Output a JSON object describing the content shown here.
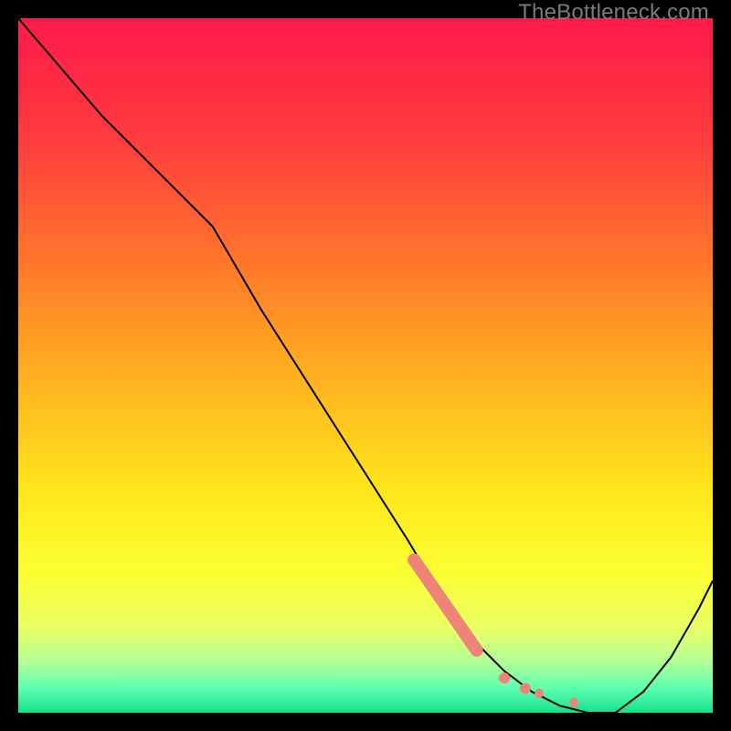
{
  "watermark": "TheBottleneck.com",
  "chart_data": {
    "type": "line",
    "title": "",
    "xlabel": "",
    "ylabel": "",
    "xlim": [
      0,
      100
    ],
    "ylim": [
      0,
      100
    ],
    "background_gradient": {
      "type": "vertical",
      "stops": [
        {
          "offset": 0.0,
          "color": "#ff1a4b"
        },
        {
          "offset": 0.18,
          "color": "#ff3d3d"
        },
        {
          "offset": 0.36,
          "color": "#ff7a2a"
        },
        {
          "offset": 0.52,
          "color": "#ffb21f"
        },
        {
          "offset": 0.68,
          "color": "#ffe61a"
        },
        {
          "offset": 0.8,
          "color": "#fcff33"
        },
        {
          "offset": 0.88,
          "color": "#e8ff66"
        },
        {
          "offset": 0.93,
          "color": "#acff99"
        },
        {
          "offset": 0.965,
          "color": "#5cffb0"
        },
        {
          "offset": 1.0,
          "color": "#18e08c"
        }
      ]
    },
    "series": [
      {
        "name": "bottleneck-curve",
        "color": "#000000",
        "width": 2,
        "x": [
          0,
          6,
          12,
          20,
          28,
          35,
          42,
          49,
          56,
          62,
          66,
          70,
          74,
          78,
          82,
          86,
          90,
          94,
          98,
          100
        ],
        "y": [
          100,
          93,
          86,
          78,
          70,
          58,
          47,
          36,
          25,
          15,
          10,
          6,
          3,
          1,
          0,
          0,
          3,
          8,
          15,
          19
        ]
      }
    ],
    "highlight": {
      "color": "#ee8378",
      "thick_segment": {
        "x": [
          57,
          66
        ],
        "y": [
          22,
          9
        ]
      },
      "dots": [
        {
          "x": 57,
          "y": 22
        },
        {
          "x": 66,
          "y": 9
        },
        {
          "x": 70,
          "y": 5
        },
        {
          "x": 73,
          "y": 3.5
        },
        {
          "x": 75,
          "y": 2.8
        },
        {
          "x": 80,
          "y": 1.5
        }
      ]
    }
  }
}
